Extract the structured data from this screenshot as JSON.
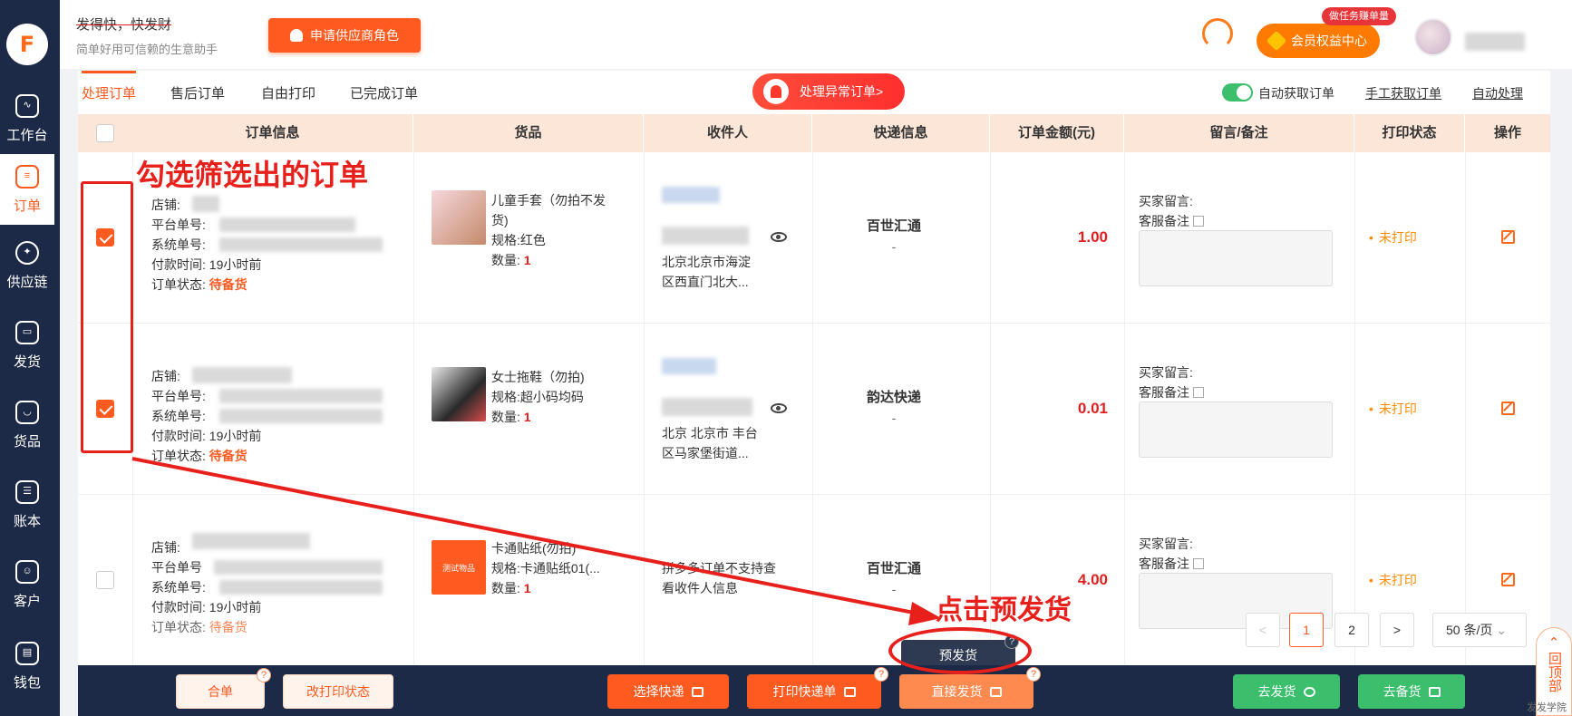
{
  "sidebar": {
    "items": [
      {
        "label": "工作台"
      },
      {
        "label": "订单"
      },
      {
        "label": "供应链"
      },
      {
        "label": "发货"
      },
      {
        "label": "货品"
      },
      {
        "label": "账本"
      },
      {
        "label": "客户"
      },
      {
        "label": "钱包"
      }
    ]
  },
  "header": {
    "brand_title": "发得快，快发财",
    "brand_sub": "简单好用可信赖的生意助手",
    "apply_btn": "申请供应商角色",
    "member_btn": "会员权益中心",
    "task_badge": "做任务赚单量"
  },
  "tabs": [
    "处理订单",
    "售后订单",
    "自由打印",
    "已完成订单"
  ],
  "abnormal_btn": "处理异常订单>",
  "auto_fetch": "自动获取订单",
  "manual_fetch": "手工获取订单",
  "auto_process": "自动处理",
  "columns": [
    "订单信息",
    "货品",
    "收件人",
    "快递信息",
    "订单金额(元)",
    "留言/备注",
    "打印状态",
    "操作"
  ],
  "labels": {
    "shop": "店铺:",
    "platform_no": "平台单号:",
    "platform_no_cut": "平台单号",
    "system_no": "系统单号:",
    "pay_time": "付款时间:",
    "order_status": "订单状态:",
    "spec_prefix": "规格:",
    "qty": "数量:",
    "buyer_msg": "买家留言:",
    "cs_note": "客服备注"
  },
  "orders": [
    {
      "checked": true,
      "pay_time": "19小时前",
      "status": "待备货",
      "product_name_1": "儿童手套（勿拍不发",
      "product_name_2": "货)",
      "spec": "规格:红色",
      "qty": "1",
      "address_1": "北京北京市海淀",
      "address_2": "区西直门北大...",
      "courier": "百世汇通",
      "courier_sub": "-",
      "amount": "1.00",
      "print_status": "未打印"
    },
    {
      "checked": true,
      "pay_time": "19小时前",
      "status": "待备货",
      "product_name_1": "女士拖鞋（勿拍)",
      "spec": "规格:超小码均码",
      "qty": "1",
      "address_1": "北京 北京市 丰台",
      "address_2": "区马家堡街道...",
      "courier": "韵达快递",
      "courier_sub": "-",
      "amount": "0.01",
      "print_status": "未打印"
    },
    {
      "checked": false,
      "pay_time": "19小时前",
      "status": "待备货",
      "product_name_1": "卡通贴纸(勿拍)",
      "spec": "规格:卡通贴纸01(...",
      "qty": "1",
      "thumb_text": "测试物品",
      "recv_note_1": "拼多多订单不支持查",
      "recv_note_2": "看收件人信息",
      "courier": "百世汇通",
      "courier_sub": "-",
      "amount": "4.00",
      "print_status": "未打印"
    }
  ],
  "pagination": {
    "prev": "<",
    "page1": "1",
    "page2": "2",
    "next": ">",
    "per_page": "50 条/页"
  },
  "bottom": {
    "merge": "合单",
    "change_print": "改打印状态",
    "choose_courier": "选择快递",
    "print_waybill": "打印快递单",
    "direct_ship": "直接发货",
    "go_ship": "去发货",
    "go_stock": "去备货",
    "pre_ship": "预发货",
    "qmark": "?"
  },
  "back_top": "回顶部",
  "watermark": "发发学院",
  "annotations": {
    "select_hint": "勾选筛选出的订单",
    "click_hint": "点击预发货"
  },
  "colors": {
    "accent": "#ff5a1f",
    "sidebar_bg": "#1d2a47",
    "annotation_red": "#e8201c",
    "amount_red": "#e02020",
    "green": "#3bbf6c"
  }
}
